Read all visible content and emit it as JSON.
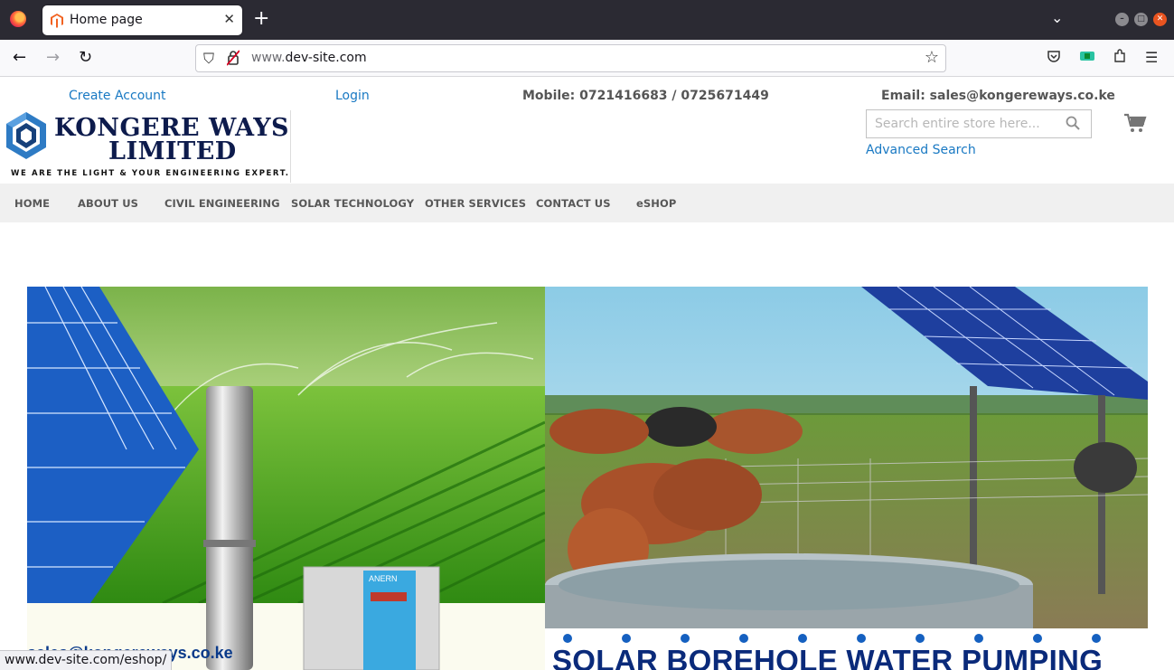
{
  "browser": {
    "tab_title": "Home page",
    "url_prefix": "www.",
    "url_domain": "dev-site.com",
    "status_url": "www.dev-site.com/eshop/"
  },
  "header": {
    "create_account": "Create Account",
    "login": "Login",
    "mobile": "Mobile: 0721416683 / 0725671449",
    "email": "Email: sales@kongereways.co.ke",
    "logo_line1": "KONGERE WAYS",
    "logo_line2": "LIMITED",
    "logo_tagline": "WE ARE THE LIGHT & YOUR ENGINEERING EXPERT.",
    "search_placeholder": "Search entire store here...",
    "advanced_search": "Advanced Search"
  },
  "menu": {
    "items": [
      "HOME",
      "ABOUT US",
      "CIVIL ENGINEERING",
      "SOLAR TECHNOLOGY",
      "OTHER SERVICES",
      "CONTACT US",
      "eSHOP"
    ]
  },
  "banner": {
    "left_email": "sales@kongereways.co.ke",
    "pump_brand": "ANERN",
    "right_caption": "SOLAR BOREHOLE WATER PUMPING"
  },
  "colors": {
    "link": "#1979c3",
    "logo_navy": "#0d1b4c",
    "menu_bg": "#f0f0f0",
    "caption_blue": "#0a2a7a"
  },
  "icons": [
    "firefox-icon",
    "magento-favicon",
    "back-arrow-icon",
    "forward-arrow-icon",
    "reload-icon",
    "shield-icon",
    "lock-icon",
    "bookmark-star-icon",
    "pocket-icon",
    "extensions-icon",
    "menu-icon",
    "search-icon",
    "cart-icon"
  ]
}
